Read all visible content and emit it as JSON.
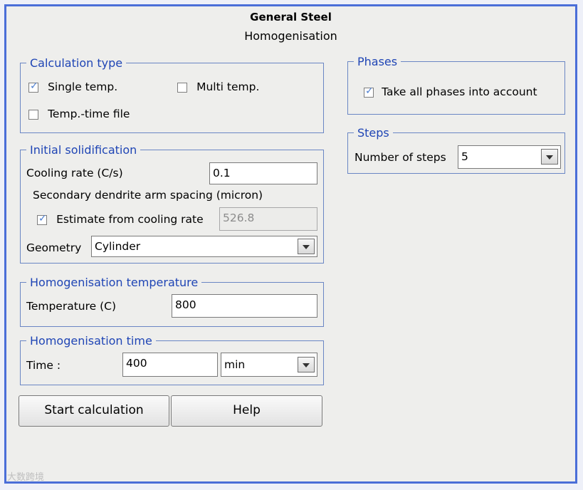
{
  "header": {
    "title": "General Steel",
    "subtitle": "Homogenisation"
  },
  "calc_type": {
    "legend": "Calculation type",
    "single_temp": {
      "label": "Single temp.",
      "checked": true
    },
    "multi_temp": {
      "label": "Multi temp.",
      "checked": false
    },
    "temp_time_file": {
      "label": "Temp.-time file",
      "checked": false
    }
  },
  "initial_solidification": {
    "legend": "Initial solidification",
    "cooling_rate_label": "Cooling rate (C/s)",
    "cooling_rate_value": "0.1",
    "sdas_label": "Secondary dendrite arm spacing (micron)",
    "estimate": {
      "label": "Estimate from cooling rate",
      "checked": true
    },
    "sdas_value": "526.8",
    "geometry_label": "Geometry",
    "geometry_value": "Cylinder"
  },
  "homog_temp": {
    "legend": "Homogenisation temperature",
    "label": "Temperature (C)",
    "value": "800"
  },
  "homog_time": {
    "legend": "Homogenisation time",
    "label": "Time :",
    "value": "400",
    "unit": "min"
  },
  "buttons": {
    "start": "Start calculation",
    "help": "Help"
  },
  "phases": {
    "legend": "Phases",
    "take_all": {
      "label": "Take all phases into account",
      "checked": true
    }
  },
  "steps": {
    "legend": "Steps",
    "label": "Number of steps",
    "value": "5"
  },
  "watermark": "大数跨境",
  "colors": {
    "frame_border": "#4a6ed8",
    "legend_text": "#1f45b5",
    "group_border": "#6a86c4"
  }
}
